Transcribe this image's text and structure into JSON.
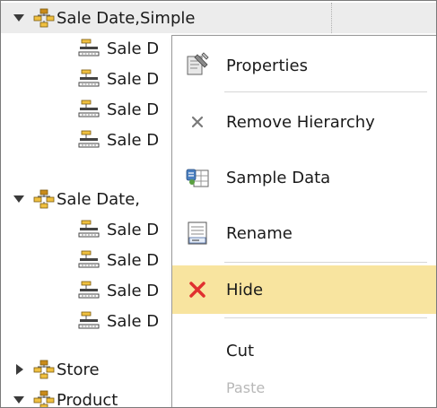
{
  "tree": {
    "rows": [
      {
        "kind": "hierarchy",
        "label": "Sale Date,Simple",
        "twisty": "down",
        "selected": true
      },
      {
        "kind": "level",
        "label": "Sale D"
      },
      {
        "kind": "level",
        "label": "Sale D"
      },
      {
        "kind": "level",
        "label": "Sale D"
      },
      {
        "kind": "level",
        "label": "Sale D"
      },
      {
        "kind": "hierarchy",
        "label": "Sale Date,",
        "twisty": "down"
      },
      {
        "kind": "level",
        "label": "Sale D"
      },
      {
        "kind": "level",
        "label": "Sale D"
      },
      {
        "kind": "level",
        "label": "Sale D"
      },
      {
        "kind": "level",
        "label": "Sale D"
      },
      {
        "kind": "hierarchy",
        "label": "Store",
        "twisty": "right"
      },
      {
        "kind": "hierarchy",
        "label": "Product",
        "twisty": "down"
      }
    ]
  },
  "context_menu": {
    "items": [
      {
        "label": "Properties",
        "icon": "properties-icon"
      },
      {
        "label": "Remove Hierarchy",
        "icon": "remove-icon"
      },
      {
        "label": "Sample Data",
        "icon": "sample-data-icon"
      },
      {
        "label": "Rename",
        "icon": "rename-icon"
      },
      {
        "label": "Hide",
        "icon": "hide-icon",
        "highlighted": true
      },
      {
        "label": "Cut",
        "icon": null
      },
      {
        "label": "Paste",
        "icon": null,
        "disabled": true
      }
    ]
  },
  "colors": {
    "highlight": "#f8e49f",
    "hide_icon": "#e03030",
    "hierarchy_icon": "#c98a1a",
    "selected_row": "#ececec"
  }
}
